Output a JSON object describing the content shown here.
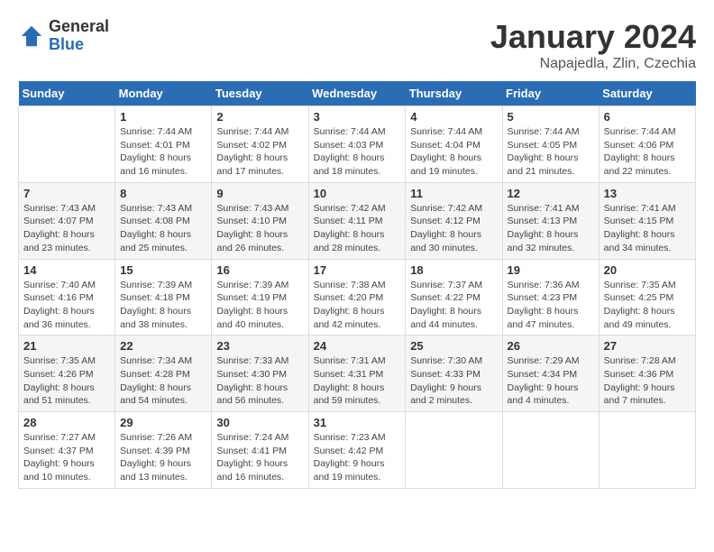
{
  "logo": {
    "general": "General",
    "blue": "Blue"
  },
  "title": {
    "month_year": "January 2024",
    "location": "Napajedla, Zlin, Czechia"
  },
  "weekdays": [
    "Sunday",
    "Monday",
    "Tuesday",
    "Wednesday",
    "Thursday",
    "Friday",
    "Saturday"
  ],
  "weeks": [
    [
      {
        "day": "",
        "sunrise": "",
        "sunset": "",
        "daylight": ""
      },
      {
        "day": "1",
        "sunrise": "Sunrise: 7:44 AM",
        "sunset": "Sunset: 4:01 PM",
        "daylight": "Daylight: 8 hours and 16 minutes."
      },
      {
        "day": "2",
        "sunrise": "Sunrise: 7:44 AM",
        "sunset": "Sunset: 4:02 PM",
        "daylight": "Daylight: 8 hours and 17 minutes."
      },
      {
        "day": "3",
        "sunrise": "Sunrise: 7:44 AM",
        "sunset": "Sunset: 4:03 PM",
        "daylight": "Daylight: 8 hours and 18 minutes."
      },
      {
        "day": "4",
        "sunrise": "Sunrise: 7:44 AM",
        "sunset": "Sunset: 4:04 PM",
        "daylight": "Daylight: 8 hours and 19 minutes."
      },
      {
        "day": "5",
        "sunrise": "Sunrise: 7:44 AM",
        "sunset": "Sunset: 4:05 PM",
        "daylight": "Daylight: 8 hours and 21 minutes."
      },
      {
        "day": "6",
        "sunrise": "Sunrise: 7:44 AM",
        "sunset": "Sunset: 4:06 PM",
        "daylight": "Daylight: 8 hours and 22 minutes."
      }
    ],
    [
      {
        "day": "7",
        "sunrise": "Sunrise: 7:43 AM",
        "sunset": "Sunset: 4:07 PM",
        "daylight": "Daylight: 8 hours and 23 minutes."
      },
      {
        "day": "8",
        "sunrise": "Sunrise: 7:43 AM",
        "sunset": "Sunset: 4:08 PM",
        "daylight": "Daylight: 8 hours and 25 minutes."
      },
      {
        "day": "9",
        "sunrise": "Sunrise: 7:43 AM",
        "sunset": "Sunset: 4:10 PM",
        "daylight": "Daylight: 8 hours and 26 minutes."
      },
      {
        "day": "10",
        "sunrise": "Sunrise: 7:42 AM",
        "sunset": "Sunset: 4:11 PM",
        "daylight": "Daylight: 8 hours and 28 minutes."
      },
      {
        "day": "11",
        "sunrise": "Sunrise: 7:42 AM",
        "sunset": "Sunset: 4:12 PM",
        "daylight": "Daylight: 8 hours and 30 minutes."
      },
      {
        "day": "12",
        "sunrise": "Sunrise: 7:41 AM",
        "sunset": "Sunset: 4:13 PM",
        "daylight": "Daylight: 8 hours and 32 minutes."
      },
      {
        "day": "13",
        "sunrise": "Sunrise: 7:41 AM",
        "sunset": "Sunset: 4:15 PM",
        "daylight": "Daylight: 8 hours and 34 minutes."
      }
    ],
    [
      {
        "day": "14",
        "sunrise": "Sunrise: 7:40 AM",
        "sunset": "Sunset: 4:16 PM",
        "daylight": "Daylight: 8 hours and 36 minutes."
      },
      {
        "day": "15",
        "sunrise": "Sunrise: 7:39 AM",
        "sunset": "Sunset: 4:18 PM",
        "daylight": "Daylight: 8 hours and 38 minutes."
      },
      {
        "day": "16",
        "sunrise": "Sunrise: 7:39 AM",
        "sunset": "Sunset: 4:19 PM",
        "daylight": "Daylight: 8 hours and 40 minutes."
      },
      {
        "day": "17",
        "sunrise": "Sunrise: 7:38 AM",
        "sunset": "Sunset: 4:20 PM",
        "daylight": "Daylight: 8 hours and 42 minutes."
      },
      {
        "day": "18",
        "sunrise": "Sunrise: 7:37 AM",
        "sunset": "Sunset: 4:22 PM",
        "daylight": "Daylight: 8 hours and 44 minutes."
      },
      {
        "day": "19",
        "sunrise": "Sunrise: 7:36 AM",
        "sunset": "Sunset: 4:23 PM",
        "daylight": "Daylight: 8 hours and 47 minutes."
      },
      {
        "day": "20",
        "sunrise": "Sunrise: 7:35 AM",
        "sunset": "Sunset: 4:25 PM",
        "daylight": "Daylight: 8 hours and 49 minutes."
      }
    ],
    [
      {
        "day": "21",
        "sunrise": "Sunrise: 7:35 AM",
        "sunset": "Sunset: 4:26 PM",
        "daylight": "Daylight: 8 hours and 51 minutes."
      },
      {
        "day": "22",
        "sunrise": "Sunrise: 7:34 AM",
        "sunset": "Sunset: 4:28 PM",
        "daylight": "Daylight: 8 hours and 54 minutes."
      },
      {
        "day": "23",
        "sunrise": "Sunrise: 7:33 AM",
        "sunset": "Sunset: 4:30 PM",
        "daylight": "Daylight: 8 hours and 56 minutes."
      },
      {
        "day": "24",
        "sunrise": "Sunrise: 7:31 AM",
        "sunset": "Sunset: 4:31 PM",
        "daylight": "Daylight: 8 hours and 59 minutes."
      },
      {
        "day": "25",
        "sunrise": "Sunrise: 7:30 AM",
        "sunset": "Sunset: 4:33 PM",
        "daylight": "Daylight: 9 hours and 2 minutes."
      },
      {
        "day": "26",
        "sunrise": "Sunrise: 7:29 AM",
        "sunset": "Sunset: 4:34 PM",
        "daylight": "Daylight: 9 hours and 4 minutes."
      },
      {
        "day": "27",
        "sunrise": "Sunrise: 7:28 AM",
        "sunset": "Sunset: 4:36 PM",
        "daylight": "Daylight: 9 hours and 7 minutes."
      }
    ],
    [
      {
        "day": "28",
        "sunrise": "Sunrise: 7:27 AM",
        "sunset": "Sunset: 4:37 PM",
        "daylight": "Daylight: 9 hours and 10 minutes."
      },
      {
        "day": "29",
        "sunrise": "Sunrise: 7:26 AM",
        "sunset": "Sunset: 4:39 PM",
        "daylight": "Daylight: 9 hours and 13 minutes."
      },
      {
        "day": "30",
        "sunrise": "Sunrise: 7:24 AM",
        "sunset": "Sunset: 4:41 PM",
        "daylight": "Daylight: 9 hours and 16 minutes."
      },
      {
        "day": "31",
        "sunrise": "Sunrise: 7:23 AM",
        "sunset": "Sunset: 4:42 PM",
        "daylight": "Daylight: 9 hours and 19 minutes."
      },
      {
        "day": "",
        "sunrise": "",
        "sunset": "",
        "daylight": ""
      },
      {
        "day": "",
        "sunrise": "",
        "sunset": "",
        "daylight": ""
      },
      {
        "day": "",
        "sunrise": "",
        "sunset": "",
        "daylight": ""
      }
    ]
  ]
}
